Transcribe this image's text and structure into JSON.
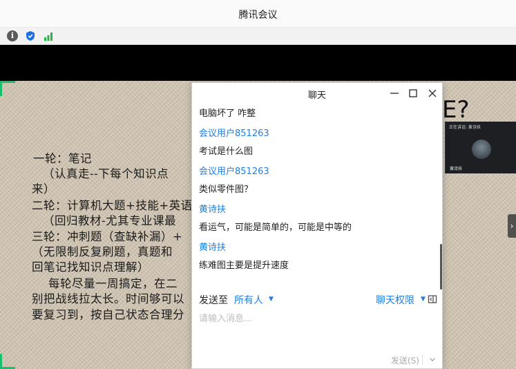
{
  "window": {
    "title": "腾讯会议"
  },
  "toolbar": {
    "icons": [
      "info-icon",
      "shield-icon",
      "signal-icon"
    ],
    "info_glyph": "i"
  },
  "slide": {
    "lines": [
      "一轮：笔记",
      "（认真走--下每个知识点",
      "来）",
      "二轮：计算机大题+技能+英语",
      "（回归教材-尤其专业课最",
      "三轮：冲刺题（查缺补漏）+",
      "（无限制反复刷题，真题和",
      "回笔记找知识点理解）",
      "每轮尽量一周搞定，在二",
      "别把战线拉太长。时间够可以",
      "要复习到，按自己状态合理分"
    ],
    "corner_text": "E?"
  },
  "participant": {
    "top_text": "正在讲话: 黄诗扶",
    "name": "黄诗扶"
  },
  "chat": {
    "title": "聊天",
    "messages": [
      {
        "kind": "text",
        "text": "电脑坏了 咋整"
      },
      {
        "kind": "name",
        "text": "会议用户851263"
      },
      {
        "kind": "text",
        "text": "考试是什么图"
      },
      {
        "kind": "name",
        "text": "会议用户851263"
      },
      {
        "kind": "text",
        "text": "类似零件图？"
      },
      {
        "kind": "name",
        "text": "黄诗扶"
      },
      {
        "kind": "text",
        "text": "看运气，可能是简单的，可能是中等的"
      },
      {
        "kind": "name",
        "text": "黄诗扶"
      },
      {
        "kind": "text",
        "text": "练难图主要是提升速度"
      }
    ],
    "send_to_label": "发送至",
    "send_to_value": "所有人",
    "permission_label": "聊天权限",
    "input_placeholder": "请输入消息...",
    "send_button": "发送(S)"
  },
  "colors": {
    "accent": "#1f7fe0",
    "green_frame": "#18c06b",
    "slide_bg": "#d2c7b4"
  }
}
